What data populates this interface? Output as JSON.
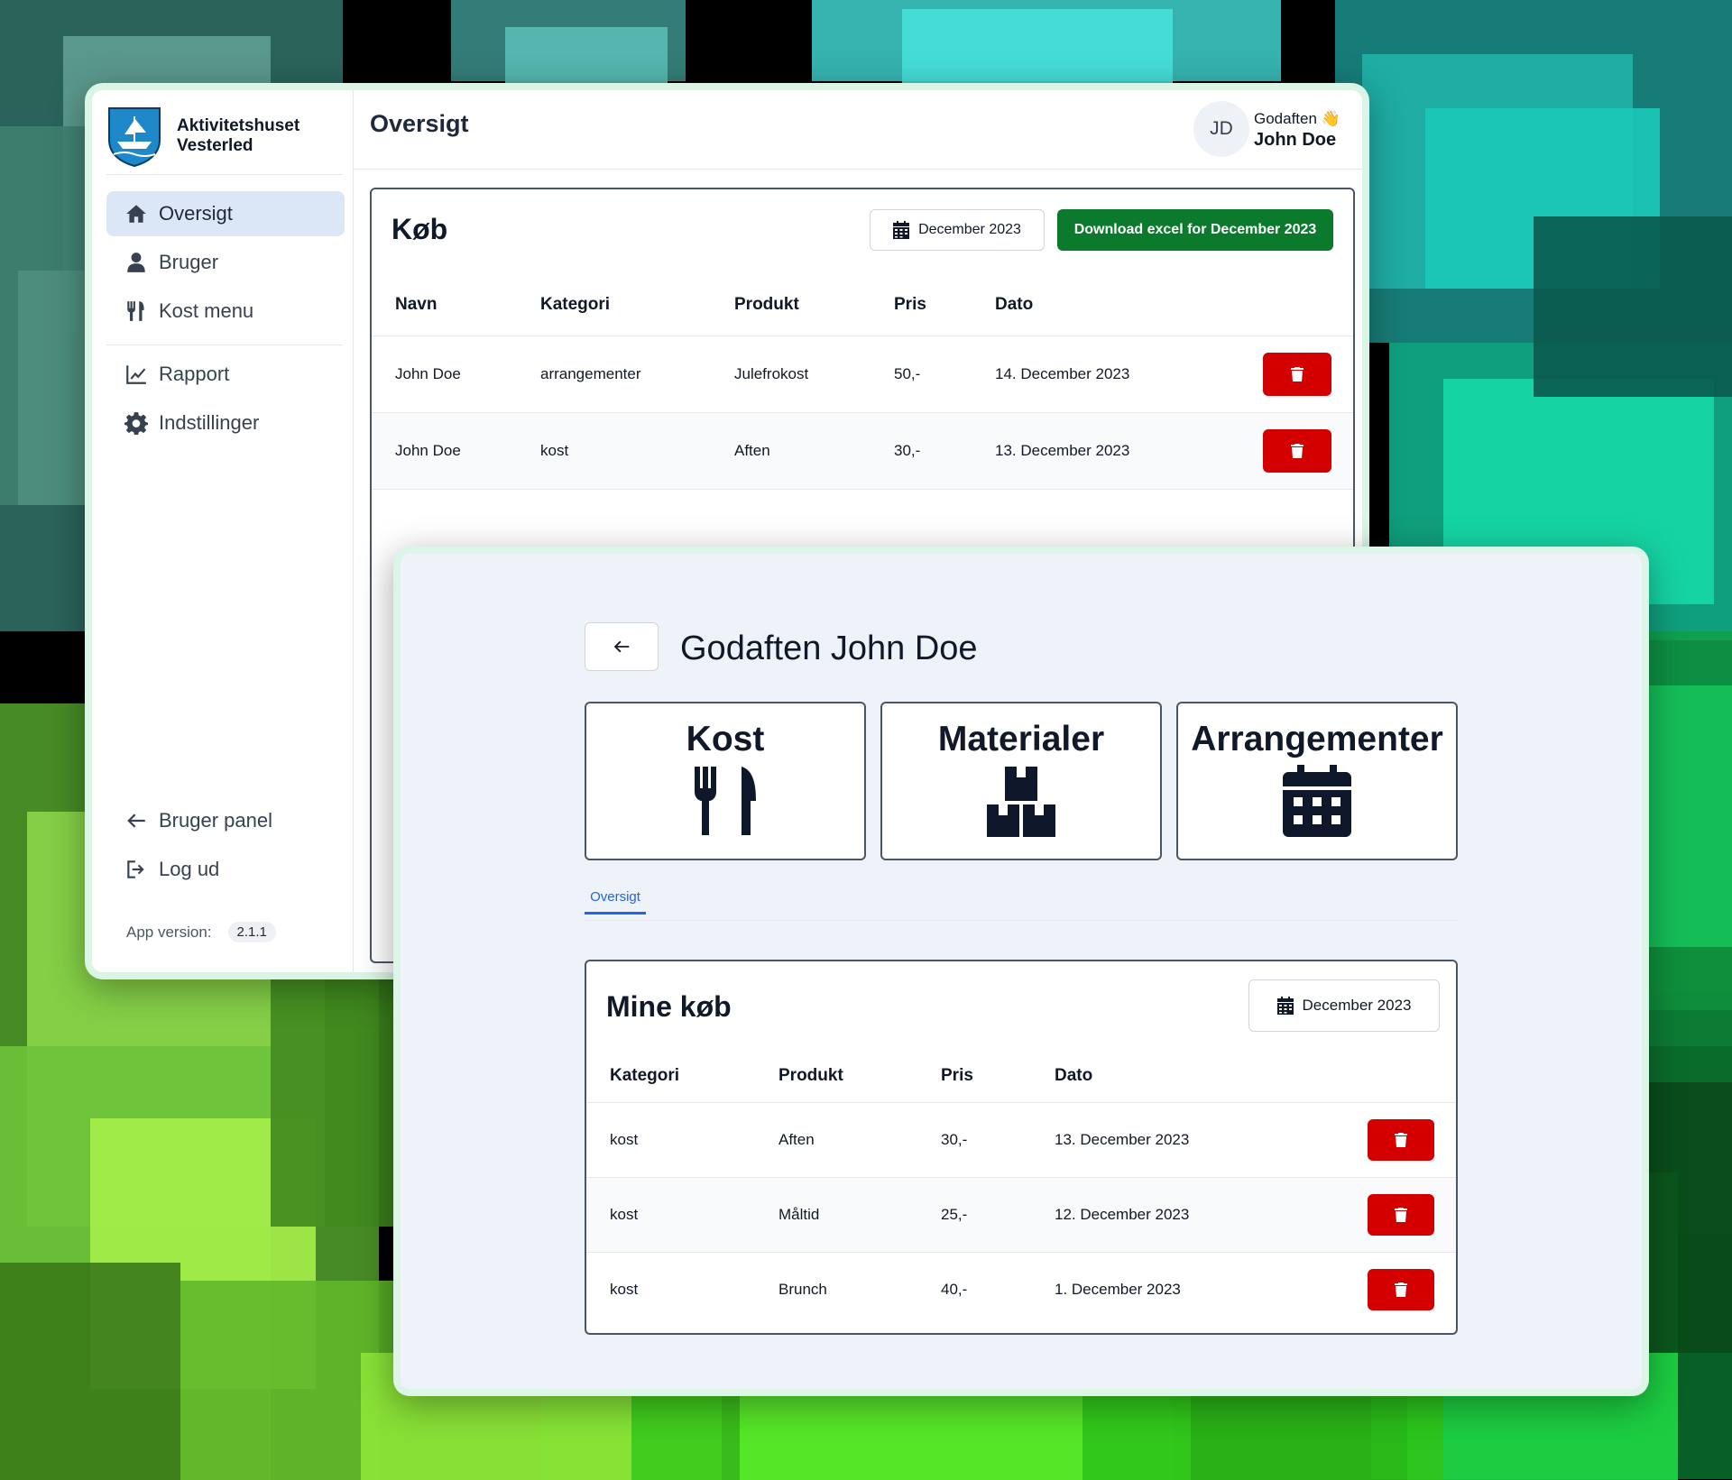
{
  "admin": {
    "brand": {
      "line1": "Aktivitetshuset",
      "line2": "Vesterled"
    },
    "nav": {
      "oversigt": "Oversigt",
      "bruger": "Bruger",
      "kost_menu": "Kost menu",
      "rapport": "Rapport",
      "indstillinger": "Indstillinger",
      "bruger_panel": "Bruger panel",
      "log_ud": "Log ud"
    },
    "version_label": "App version:",
    "version_value": "2.1.1",
    "page_title": "Oversigt",
    "user": {
      "initials": "JD",
      "greeting": "Godaften 👋",
      "name": "John Doe"
    },
    "purchases": {
      "title": "Køb",
      "month_button": "December 2023",
      "download_button": "Download excel for December 2023",
      "columns": [
        "Navn",
        "Kategori",
        "Produkt",
        "Pris",
        "Dato"
      ],
      "rows": [
        {
          "navn": "John Doe",
          "kategori": "arrangementer",
          "produkt": "Julefrokost",
          "pris": "50,-",
          "dato": "14. December 2023"
        },
        {
          "navn": "John Doe",
          "kategori": "kost",
          "produkt": "Aften",
          "pris": "30,-",
          "dato": "13. December 2023"
        }
      ]
    }
  },
  "user_panel": {
    "greeting": "Godaften John Doe",
    "categories": [
      {
        "label": "Kost",
        "icon": "utensils-icon"
      },
      {
        "label": "Materialer",
        "icon": "boxes-icon"
      },
      {
        "label": "Arrangementer",
        "icon": "calendar-icon"
      }
    ],
    "tab": "Oversigt",
    "my_purchases": {
      "title": "Mine køb",
      "month_button": "December 2023",
      "columns": [
        "Kategori",
        "Produkt",
        "Pris",
        "Dato"
      ],
      "rows": [
        {
          "kategori": "kost",
          "produkt": "Aften",
          "pris": "30,-",
          "dato": "13. December 2023"
        },
        {
          "kategori": "kost",
          "produkt": "Måltid",
          "pris": "25,-",
          "dato": "12. December 2023"
        },
        {
          "kategori": "kost",
          "produkt": "Brunch",
          "pris": "40,-",
          "dato": "1. December 2023"
        }
      ]
    }
  },
  "colors": {
    "accent": "#2563eb",
    "download": "#0b7a2c",
    "delete": "#d40000",
    "active_nav": "#dbe7f7"
  }
}
